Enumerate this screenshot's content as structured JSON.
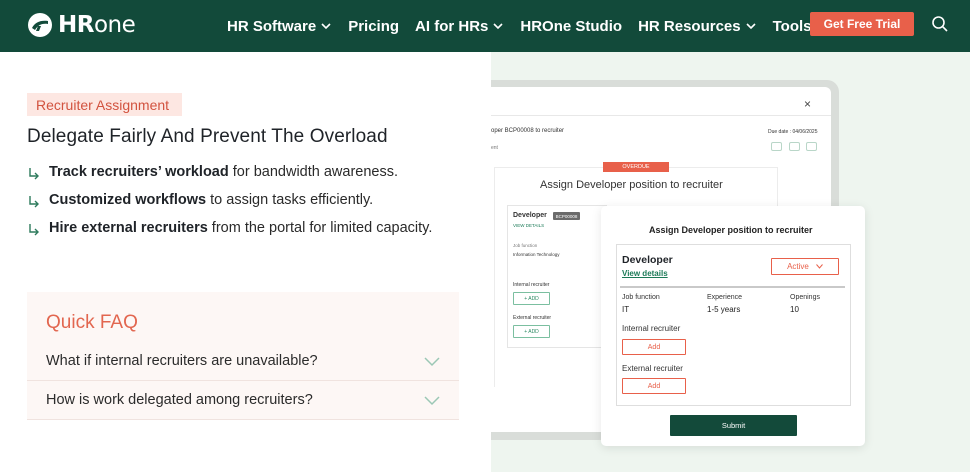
{
  "nav": {
    "logo": {
      "bold": "HR",
      "light": "one"
    },
    "items": [
      {
        "label": "HR Software",
        "dropdown": true
      },
      {
        "label": "Pricing",
        "dropdown": false
      },
      {
        "label": "AI for HRs",
        "dropdown": true
      },
      {
        "label": "HROne Studio",
        "dropdown": false
      },
      {
        "label": "HR Resources",
        "dropdown": true
      },
      {
        "label": "Tools",
        "dropdown": true
      }
    ],
    "cta_label": "Get Free Trial",
    "search_icon": "search-icon"
  },
  "hero": {
    "badge": "Recruiter Assignment",
    "headline": "Delegate Fairly And Prevent The Overload",
    "bullets": [
      {
        "bold": "Track recruiters’ workload",
        "rest": " for bandwidth awareness."
      },
      {
        "bold": "Customized workflows",
        "rest": " to assign tasks efficiently."
      },
      {
        "bold": "Hire external recruiters",
        "rest": " from the portal for limited capacity."
      }
    ]
  },
  "faq": {
    "title": "Quick FAQ",
    "items": [
      "What if internal recruiters are unavailable?",
      "How is work delegated among recruiters?"
    ]
  },
  "illustration": {
    "back": {
      "header": "oper BCP00008 to recruiter",
      "subheader": "ent",
      "due_date": "Due date : 04/06/2025",
      "overdue": "OVERDUE",
      "title": "Assign Developer position to recruiter",
      "role": "Developer",
      "role_code": "BCP00008",
      "view_details": "VIEW DETAILS",
      "job_function_label": "Job function",
      "job_function_value": "Information Technology",
      "internal_label": "Internal recruiter",
      "external_label": "External recruiter",
      "add_label": "+ ADD",
      "close": "×"
    },
    "front": {
      "title": "Assign Developer position to recruiter",
      "role": "Developer",
      "view_details": "View details",
      "status": "Active",
      "job_function_label": "Job function",
      "job_function_value": "IT",
      "experience_label": "Experience",
      "experience_value": "1-5 years",
      "openings_label": "Openings",
      "openings_value": "10",
      "internal_label": "Internal recruiter",
      "external_label": "External recruiter",
      "add_label": "Add",
      "submit_label": "Submit"
    }
  },
  "colors": {
    "nav_bg": "#124a3a",
    "accent": "#e8604a",
    "badge_bg": "#fde7e2",
    "faq_bg": "#fdf7f5",
    "link_green": "#1b7a57",
    "right_bg": "#eef5ef"
  }
}
